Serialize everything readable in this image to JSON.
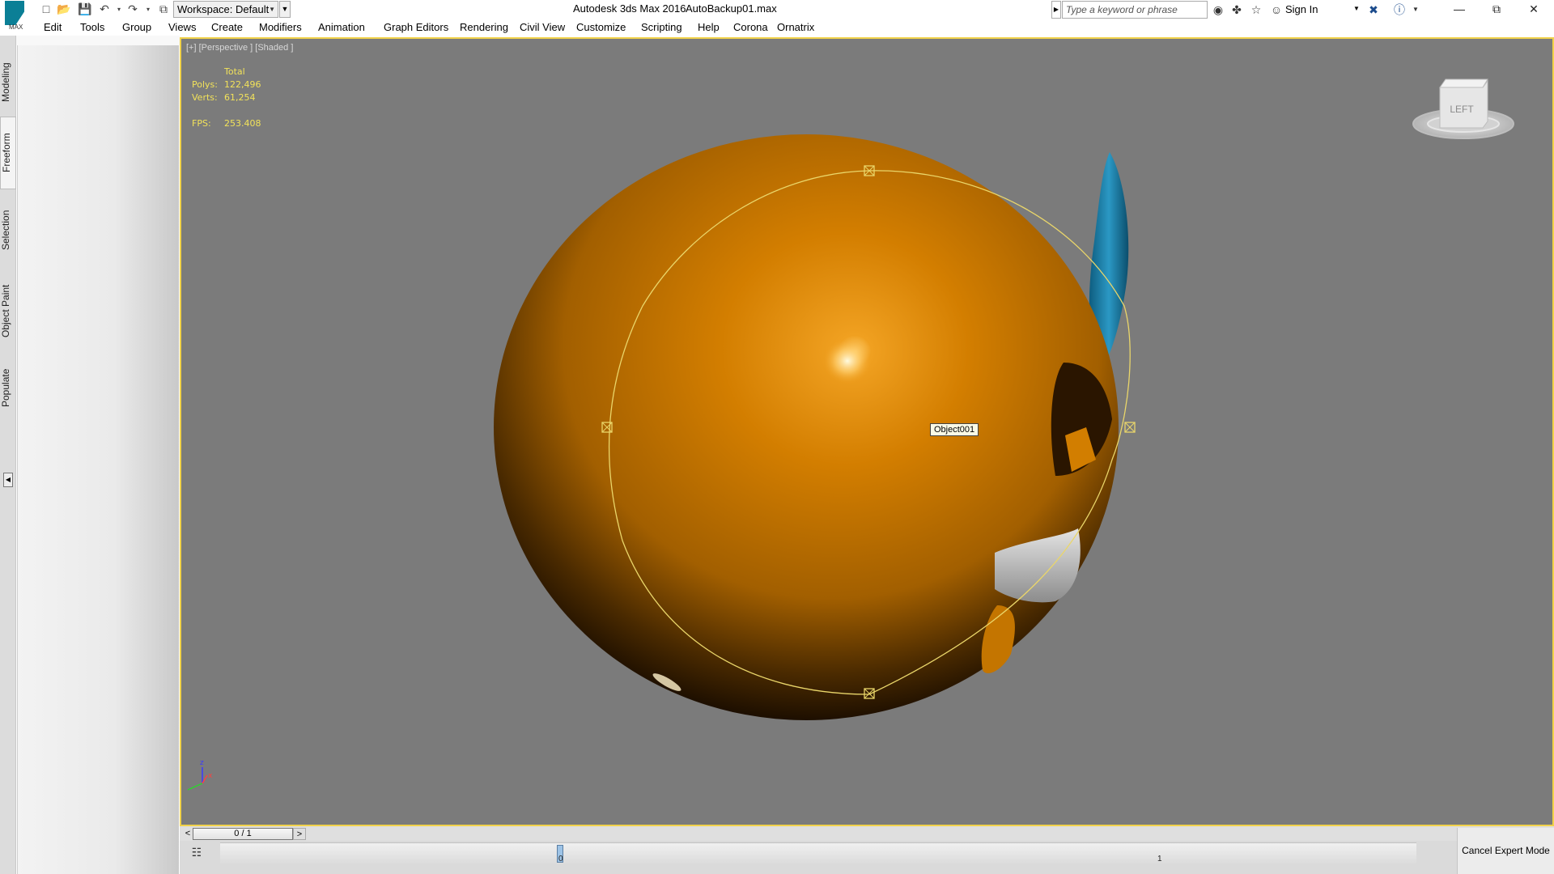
{
  "titlebar": {
    "logo_text": "MAX",
    "workspace_label": "Workspace: Default",
    "app_title": "Autodesk 3ds Max 2016",
    "file_title": "AutoBackup01.max",
    "search_placeholder": "Type a keyword or phrase",
    "sign_in": "Sign In"
  },
  "menu": [
    {
      "label": "Edit"
    },
    {
      "label": "Tools"
    },
    {
      "label": "Group"
    },
    {
      "label": "Views"
    },
    {
      "label": "Create"
    },
    {
      "label": "Modifiers"
    },
    {
      "label": "Animation"
    },
    {
      "label": "Graph Editors"
    },
    {
      "label": "Rendering"
    },
    {
      "label": "Civil View"
    },
    {
      "label": "Customize"
    },
    {
      "label": "Scripting"
    },
    {
      "label": "Help"
    },
    {
      "label": "Corona"
    },
    {
      "label": "Ornatrix"
    }
  ],
  "ribbon_tabs": [
    {
      "label": "Modeling"
    },
    {
      "label": "Freeform"
    },
    {
      "label": "Selection"
    },
    {
      "label": "Object Paint"
    },
    {
      "label": "Populate"
    }
  ],
  "viewport": {
    "label": "[+] [Perspective ] [Shaded ]",
    "stats": {
      "total_label": "Total",
      "polys_label": "Polys:",
      "polys_value": "122,496",
      "verts_label": "Verts:",
      "verts_value": "61,254",
      "fps_label": "FPS:",
      "fps_value": "253.408"
    },
    "tooltip": "Object001",
    "viewcube_label": "LEFT",
    "axis_labels": {
      "z": "z",
      "x": "x"
    }
  },
  "timeline": {
    "slider_value": "0 / 1",
    "frame_start": "0",
    "frame_end": "1",
    "cancel_expert": "Cancel Expert Mode"
  },
  "colors": {
    "viewport_bg": "#7b7b7b",
    "selection_border": "#f1d24a",
    "sphere_orange": "#d98a00",
    "ear_blue": "#1a7fa8",
    "stat_text": "#f2e25a"
  }
}
